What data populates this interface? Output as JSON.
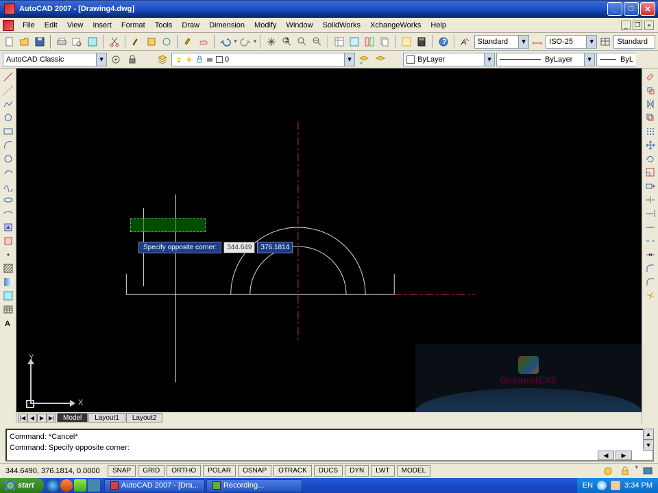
{
  "title": "AutoCAD 2007 - [Drawing4.dwg]",
  "menu": [
    "File",
    "Edit",
    "View",
    "Insert",
    "Format",
    "Tools",
    "Draw",
    "Dimension",
    "Modify",
    "Window",
    "SolidWorks",
    "XchangeWorks",
    "Help"
  ],
  "toolbar_dropdowns": {
    "text_style": "Standard",
    "dim_style": "ISO-25",
    "table_style": "Standard",
    "workspace": "AutoCAD Classic",
    "layer": "0",
    "color": "ByLayer",
    "linetype": "ByLayer",
    "lineweight": "ByL"
  },
  "canvas": {
    "tooltip_label": "Specify opposite corner:",
    "coord1": "344.649",
    "coord2": "376.1814",
    "ucs_x": "X",
    "ucs_y": "Y"
  },
  "model_tabs": {
    "nav": [
      "|◀",
      "◀",
      "▶",
      "▶|"
    ],
    "tabs": [
      "Model",
      "Layout1",
      "Layout2"
    ]
  },
  "watermark": "OceanofEXE",
  "command_lines": [
    "Command: *Cancel*",
    "",
    "Command: Specify opposite corner:"
  ],
  "status": {
    "coords": "344.6490, 376.1814, 0.0000",
    "buttons": [
      "SNAP",
      "GRID",
      "ORTHO",
      "POLAR",
      "OSNAP",
      "OTRACK",
      "DUCS",
      "DYN",
      "LWT",
      "MODEL"
    ]
  },
  "taskbar": {
    "start": "start",
    "tasks": [
      "AutoCAD 2007 - [Dra...",
      "Recording..."
    ],
    "lang": "EN",
    "clock": "3:34 PM"
  }
}
